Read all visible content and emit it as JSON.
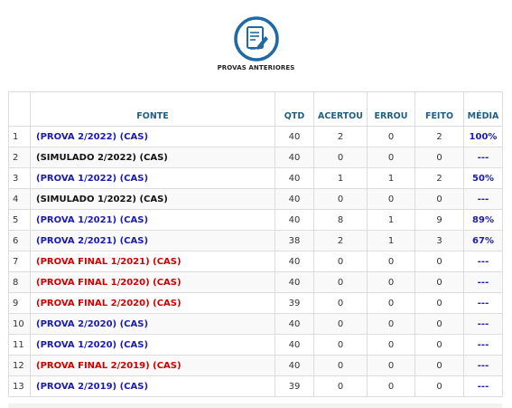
{
  "page": {
    "title": "PROVAS ANTERIORES",
    "icon": "document-edit-icon"
  },
  "colors": {
    "accent": "#1f6aa5",
    "blue": "#1a1ab3",
    "red": "#d00000",
    "black": "#111111"
  },
  "table": {
    "headers": {
      "idx": "",
      "fonte": "FONTE",
      "qtd": "QTD",
      "acertou": "ACERTOU",
      "errou": "ERROU",
      "feito": "FEITO",
      "media": "MÉDIA"
    },
    "rows": [
      {
        "idx": "1",
        "fonte": "(PROVA 2/2022) (CAS)",
        "color": "blue",
        "qtd": "40",
        "acertou": "2",
        "errou": "0",
        "feito": "2",
        "media": "100%",
        "media_color": "blue"
      },
      {
        "idx": "2",
        "fonte": "(SIMULADO 2/2022) (CAS)",
        "color": "black",
        "qtd": "40",
        "acertou": "0",
        "errou": "0",
        "feito": "0",
        "media": "---",
        "media_color": "blue"
      },
      {
        "idx": "3",
        "fonte": "(PROVA 1/2022) (CAS)",
        "color": "blue",
        "qtd": "40",
        "acertou": "1",
        "errou": "1",
        "feito": "2",
        "media": "50%",
        "media_color": "red"
      },
      {
        "idx": "4",
        "fonte": "(SIMULADO 1/2022) (CAS)",
        "color": "black",
        "qtd": "40",
        "acertou": "0",
        "errou": "0",
        "feito": "0",
        "media": "---",
        "media_color": "blue"
      },
      {
        "idx": "5",
        "fonte": "(PROVA 1/2021) (CAS)",
        "color": "blue",
        "qtd": "40",
        "acertou": "8",
        "errou": "1",
        "feito": "9",
        "media": "89%",
        "media_color": "blue"
      },
      {
        "idx": "6",
        "fonte": "(PROVA 2/2021) (CAS)",
        "color": "blue",
        "qtd": "38",
        "acertou": "2",
        "errou": "1",
        "feito": "3",
        "media": "67%",
        "media_color": "blue"
      },
      {
        "idx": "7",
        "fonte": "(PROVA FINAL 1/2021) (CAS)",
        "color": "red",
        "qtd": "40",
        "acertou": "0",
        "errou": "0",
        "feito": "0",
        "media": "---",
        "media_color": "blue"
      },
      {
        "idx": "8",
        "fonte": "(PROVA FINAL 1/2020) (CAS)",
        "color": "red",
        "qtd": "40",
        "acertou": "0",
        "errou": "0",
        "feito": "0",
        "media": "---",
        "media_color": "blue"
      },
      {
        "idx": "9",
        "fonte": "(PROVA FINAL 2/2020) (CAS)",
        "color": "red",
        "qtd": "39",
        "acertou": "0",
        "errou": "0",
        "feito": "0",
        "media": "---",
        "media_color": "blue"
      },
      {
        "idx": "10",
        "fonte": "(PROVA 2/2020) (CAS)",
        "color": "blue",
        "qtd": "40",
        "acertou": "0",
        "errou": "0",
        "feito": "0",
        "media": "---",
        "media_color": "blue"
      },
      {
        "idx": "11",
        "fonte": "(PROVA 1/2020) (CAS)",
        "color": "blue",
        "qtd": "40",
        "acertou": "0",
        "errou": "0",
        "feito": "0",
        "media": "---",
        "media_color": "blue"
      },
      {
        "idx": "12",
        "fonte": "(PROVA FINAL 2/2019) (CAS)",
        "color": "red",
        "qtd": "40",
        "acertou": "0",
        "errou": "0",
        "feito": "0",
        "media": "---",
        "media_color": "blue"
      },
      {
        "idx": "13",
        "fonte": "(PROVA 2/2019) (CAS)",
        "color": "blue",
        "qtd": "39",
        "acertou": "0",
        "errou": "0",
        "feito": "0",
        "media": "---",
        "media_color": "blue"
      }
    ]
  }
}
